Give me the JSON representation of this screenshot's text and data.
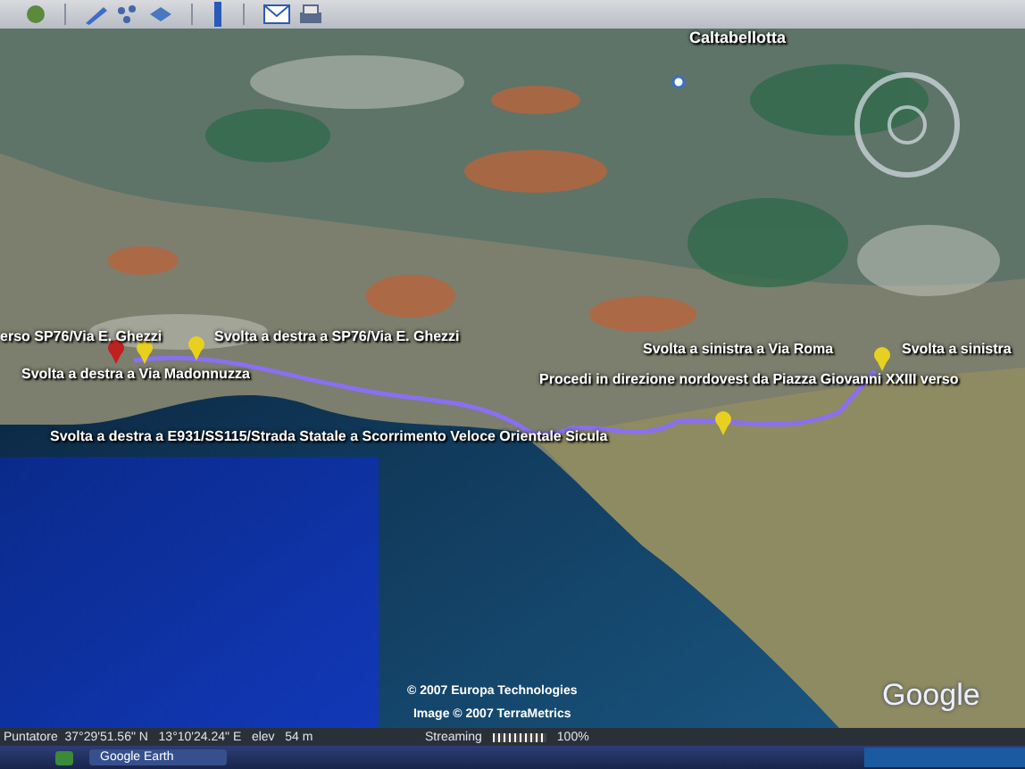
{
  "map": {
    "place_label": "Caltabellotta",
    "route_labels": [
      {
        "text": "erso SP76/Via E. Ghezzi"
      },
      {
        "text": "Svolta a destra a SP76/Via E. Ghezzi"
      },
      {
        "text": "Svolta a destra a Via Madonnuzza"
      },
      {
        "text": "Svolta a sinistra a Via Roma"
      },
      {
        "text": "Svolta a sinistra"
      },
      {
        "text": "Procedi in direzione nordovest da Piazza Giovanni XXIII verso"
      },
      {
        "text": "Svolta a destra a E931/SS115/Strada Statale a Scorrimento Veloce Orientale Sicula"
      }
    ],
    "attribution": [
      "© 2007 Europa Technologies",
      "Image © 2007 TerraMetrics"
    ],
    "logo": "Google"
  },
  "status_bar": {
    "pointer": "Puntatore  37°29'51.56\" N   13°10'24.24\" E   elev   54 m",
    "streaming": "Streaming",
    "level": 1.0,
    "streaming_percent": "100%"
  },
  "taskbar": {
    "items": [
      {
        "label": "Google Earth",
        "selected": true
      }
    ]
  }
}
